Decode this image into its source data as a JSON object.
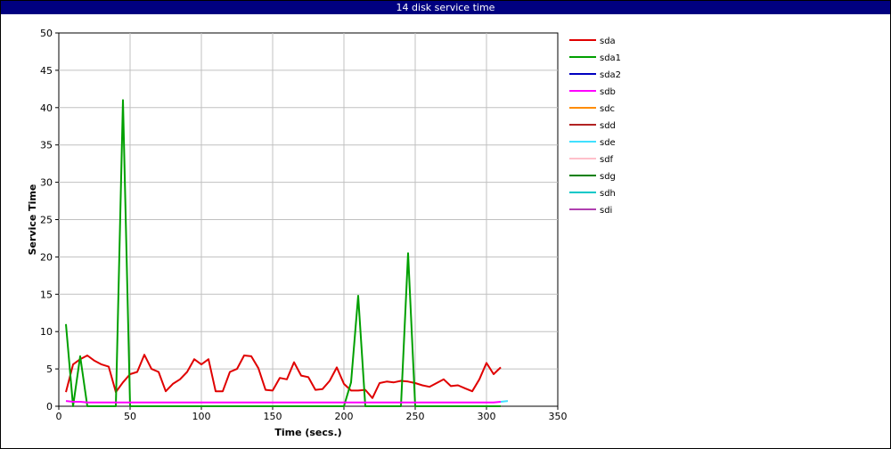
{
  "window": {
    "title": "14 disk service time"
  },
  "chart_data": {
    "type": "line",
    "title": "14 disk service time",
    "xlabel": "Time (secs.)",
    "ylabel": "Service Time",
    "xlim": [
      0,
      350
    ],
    "ylim": [
      0,
      50
    ],
    "xticks": [
      0,
      50,
      100,
      150,
      200,
      250,
      300,
      350
    ],
    "yticks": [
      0,
      5,
      10,
      15,
      20,
      25,
      30,
      35,
      40,
      45,
      50
    ],
    "grid": true,
    "legend_position": "right",
    "series": [
      {
        "name": "sda",
        "color": "#e00000",
        "x": [
          5,
          10,
          15,
          20,
          25,
          30,
          35,
          40,
          45,
          50,
          55,
          60,
          65,
          70,
          75,
          80,
          85,
          90,
          95,
          100,
          105,
          110,
          115,
          120,
          125,
          130,
          135,
          140,
          145,
          150,
          155,
          160,
          165,
          170,
          175,
          180,
          185,
          190,
          195,
          200,
          205,
          210,
          215,
          220,
          225,
          230,
          235,
          240,
          245,
          250,
          255,
          260,
          265,
          270,
          275,
          280,
          285,
          290,
          295,
          300,
          305,
          310
        ],
        "y": [
          1.9,
          5.6,
          6.3,
          6.8,
          6.1,
          5.6,
          5.3,
          1.9,
          3.2,
          4.3,
          4.6,
          6.9,
          5.0,
          4.6,
          2.0,
          3.0,
          3.6,
          4.6,
          6.3,
          5.6,
          6.3,
          2.0,
          2.0,
          4.6,
          5.0,
          6.8,
          6.7,
          5.1,
          2.2,
          2.1,
          3.8,
          3.6,
          5.9,
          4.1,
          3.9,
          2.2,
          2.3,
          3.4,
          5.2,
          3.0,
          2.1,
          2.1,
          2.2,
          1.1,
          3.1,
          3.3,
          3.2,
          3.4,
          3.3,
          3.1,
          2.8,
          2.6,
          3.1,
          3.6,
          2.7,
          2.8,
          2.4,
          2.0,
          3.6,
          5.8,
          4.3,
          5.2
        ]
      },
      {
        "name": "sda1",
        "color": "#00a000",
        "x": [
          5,
          10,
          15,
          20,
          25,
          30,
          35,
          40,
          45,
          50,
          55,
          60,
          65,
          70,
          75,
          80,
          85,
          90,
          95,
          100,
          105,
          110,
          115,
          120,
          125,
          130,
          135,
          140,
          145,
          150,
          155,
          160,
          165,
          170,
          175,
          180,
          185,
          190,
          195,
          200,
          205,
          210,
          215,
          220,
          225,
          230,
          235,
          240,
          245,
          250,
          255,
          260,
          265,
          270,
          275,
          280,
          285,
          290,
          295,
          300,
          305,
          310
        ],
        "y": [
          11.0,
          0,
          6.7,
          0,
          0,
          0,
          0,
          0,
          41.0,
          0,
          0,
          0,
          0,
          0,
          0,
          0,
          0,
          0,
          0,
          0,
          0,
          0,
          0,
          0,
          0,
          0,
          0,
          0,
          0,
          0,
          0,
          0,
          0,
          0,
          0,
          0,
          0,
          0,
          0,
          0,
          3.2,
          14.8,
          0,
          0,
          0,
          0,
          0,
          0,
          20.5,
          0,
          0,
          0,
          0,
          0,
          0,
          0,
          0,
          0,
          0,
          0,
          0,
          0
        ]
      },
      {
        "name": "sda2",
        "color": "#0000c0",
        "x": [],
        "y": []
      },
      {
        "name": "sdb",
        "color": "#ff00ff",
        "x": [
          5,
          10,
          15,
          20,
          25,
          30,
          35,
          40,
          45,
          50,
          55,
          60,
          65,
          70,
          75,
          80,
          85,
          90,
          95,
          100,
          105,
          110,
          115,
          120,
          125,
          130,
          135,
          140,
          145,
          150,
          155,
          160,
          165,
          170,
          175,
          180,
          185,
          190,
          195,
          200,
          205,
          210,
          215,
          220,
          225,
          230,
          235,
          240,
          245,
          250,
          255,
          260,
          265,
          270,
          275,
          280,
          285,
          290,
          295,
          300,
          305,
          310
        ],
        "y": [
          0.7,
          0.6,
          0.6,
          0.5,
          0.5,
          0.5,
          0.5,
          0.5,
          0.5,
          0.5,
          0.5,
          0.5,
          0.5,
          0.5,
          0.5,
          0.5,
          0.5,
          0.5,
          0.5,
          0.5,
          0.5,
          0.5,
          0.5,
          0.5,
          0.5,
          0.5,
          0.5,
          0.5,
          0.5,
          0.5,
          0.5,
          0.5,
          0.5,
          0.5,
          0.5,
          0.5,
          0.5,
          0.5,
          0.5,
          0.5,
          0.5,
          0.5,
          0.5,
          0.5,
          0.5,
          0.5,
          0.5,
          0.5,
          0.5,
          0.5,
          0.5,
          0.5,
          0.5,
          0.5,
          0.5,
          0.5,
          0.5,
          0.5,
          0.5,
          0.5,
          0.5,
          0.6
        ]
      },
      {
        "name": "sdc",
        "color": "#ff8c00",
        "x": [],
        "y": []
      },
      {
        "name": "sdd",
        "color": "#b22222",
        "x": [],
        "y": []
      },
      {
        "name": "sde",
        "color": "#40e0ff",
        "x": [
          310,
          315
        ],
        "y": [
          0.6,
          0.7
        ]
      },
      {
        "name": "sdf",
        "color": "#ffc0cb",
        "x": [],
        "y": []
      },
      {
        "name": "sdg",
        "color": "#008000",
        "x": [],
        "y": []
      },
      {
        "name": "sdh",
        "color": "#00c8c8",
        "x": [],
        "y": []
      },
      {
        "name": "sdi",
        "color": "#b040b0",
        "x": [],
        "y": []
      }
    ]
  }
}
